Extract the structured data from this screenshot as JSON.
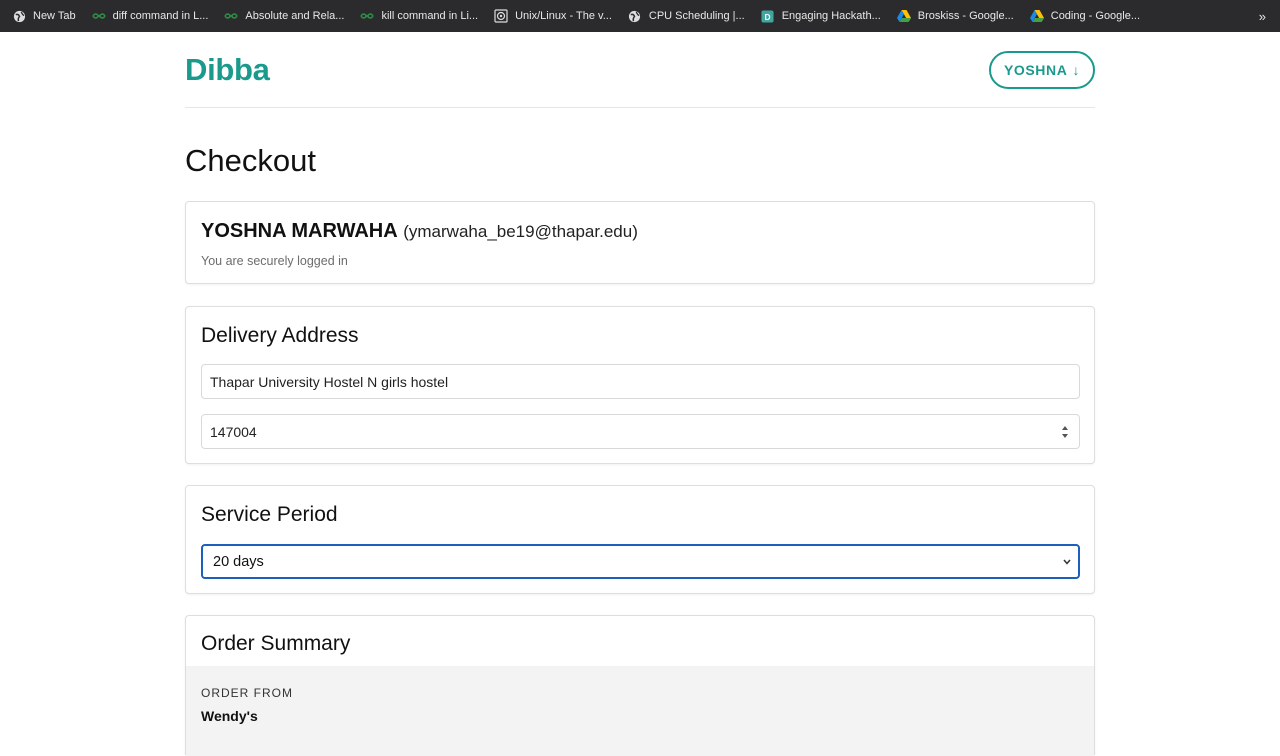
{
  "bookmarks": [
    {
      "label": "New Tab",
      "icon": "globe-icon"
    },
    {
      "label": "diff command in L...",
      "icon": "gfg-icon"
    },
    {
      "label": "Absolute and Rela...",
      "icon": "gfg-icon"
    },
    {
      "label": "kill command in Li...",
      "icon": "gfg-icon"
    },
    {
      "label": "Unix/Linux - The v...",
      "icon": "tutorialspoint-icon"
    },
    {
      "label": "CPU Scheduling |...",
      "icon": "globe-icon"
    },
    {
      "label": "Engaging Hackath...",
      "icon": "devpost-icon"
    },
    {
      "label": "Broskiss - Google...",
      "icon": "google-drive-icon"
    },
    {
      "label": "Coding - Google...",
      "icon": "google-drive-icon"
    }
  ],
  "bookmarks_more": "»",
  "header": {
    "brand": "Dibba",
    "user_button": "YOSHNA",
    "user_button_arrow": "↓"
  },
  "page_title": "Checkout",
  "account": {
    "name": "YOSHNA MARWAHA",
    "email": "(ymarwaha_be19@thapar.edu)",
    "status": "You are securely logged in"
  },
  "delivery": {
    "title": "Delivery Address",
    "address_value": "Thapar University Hostel N girls hostel",
    "pincode_value": "147004"
  },
  "service_period": {
    "title": "Service Period",
    "selected": "20 days"
  },
  "order_summary": {
    "title": "Order Summary",
    "order_from_label": "ORDER FROM",
    "restaurant": "Wendy's"
  },
  "colors": {
    "brand": "#1a9a8c",
    "focus": "#1b5fbf",
    "bookmarks_bg": "#2b2b2d"
  }
}
